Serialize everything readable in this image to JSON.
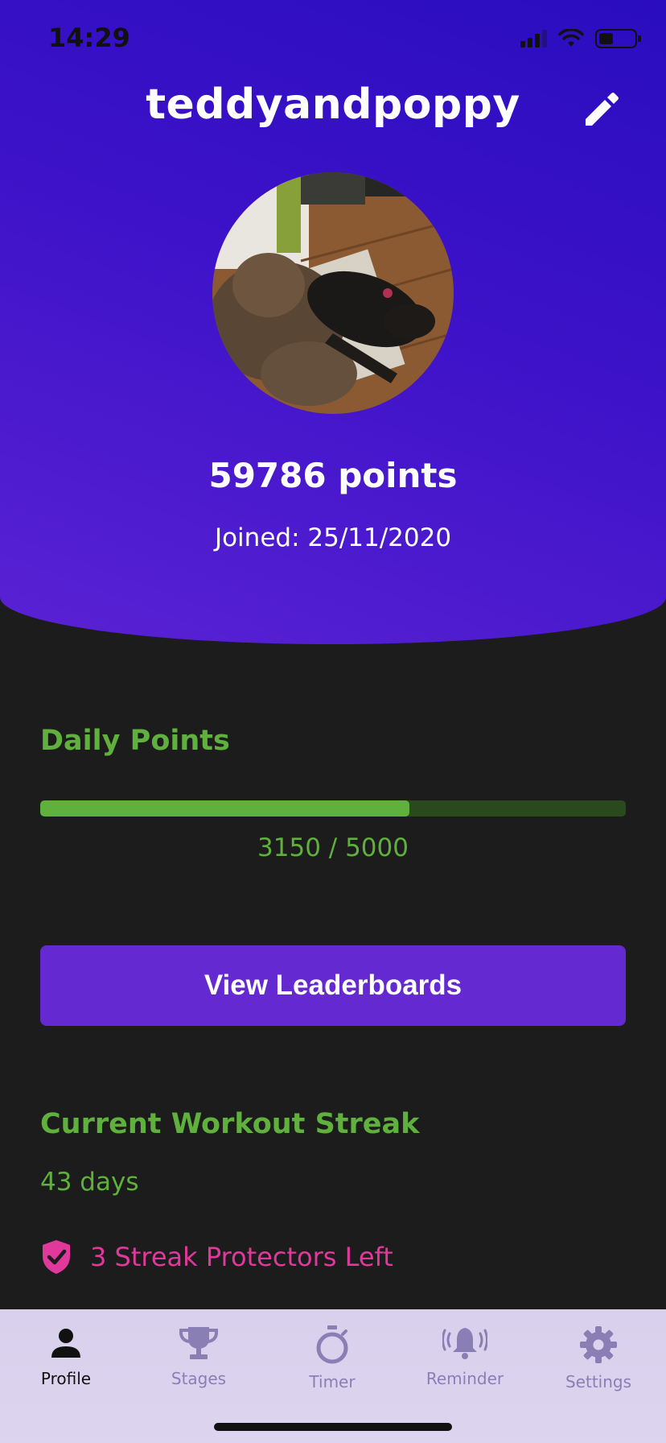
{
  "status_bar": {
    "time": "14:29"
  },
  "profile": {
    "username": "teddyandpoppy",
    "points_text": "59786 points",
    "joined_text": "Joined: 25/11/2020"
  },
  "daily_points": {
    "title": "Daily Points",
    "current": 3150,
    "goal": 5000,
    "progress_fraction": 0.63,
    "progress_text": "3150 / 5000"
  },
  "leaderboards_button": {
    "label": "View Leaderboards"
  },
  "streak": {
    "title": "Current Workout Streak",
    "days_text": "43 days",
    "protectors_text": "3 Streak Protectors Left"
  },
  "colors": {
    "accent_green": "#5fb03c",
    "accent_purple": "#6429d1",
    "protector_pink": "#e0399b",
    "header_gradient": "#3d12c8"
  },
  "tabbar": {
    "active": "profile",
    "tabs": [
      {
        "id": "profile",
        "label": "Profile",
        "icon": "person-icon"
      },
      {
        "id": "stages",
        "label": "Stages",
        "icon": "trophy-icon"
      },
      {
        "id": "timer",
        "label": "Timer",
        "icon": "stopwatch-icon"
      },
      {
        "id": "reminder",
        "label": "Reminder",
        "icon": "ringing-bell-icon"
      },
      {
        "id": "settings",
        "label": "Settings",
        "icon": "gear-icon"
      }
    ]
  }
}
